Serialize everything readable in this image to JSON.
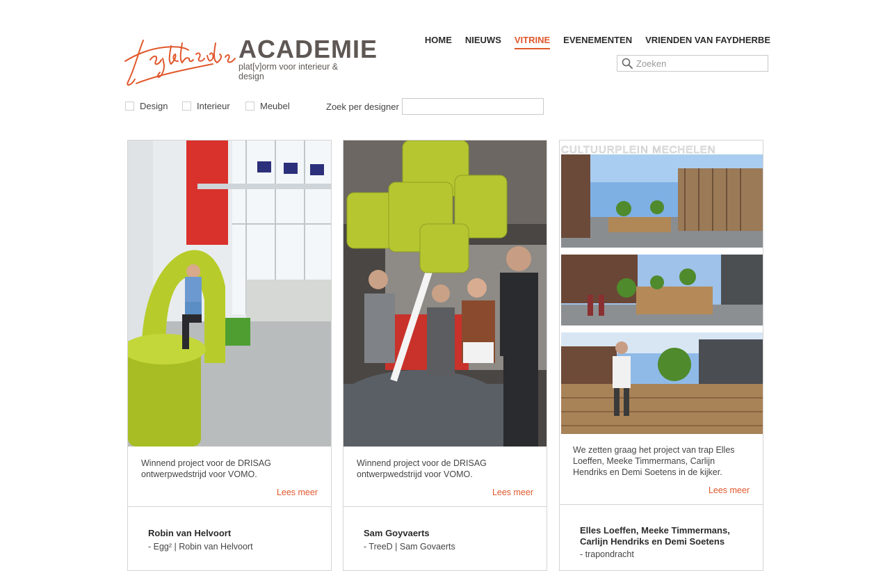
{
  "brand": {
    "signature": "Faydherbe",
    "name": "ACADEMIE",
    "tagline": "plat[v]orm voor interieur & design"
  },
  "nav": [
    {
      "label": "HOME",
      "active": false
    },
    {
      "label": "NIEUWS",
      "active": false
    },
    {
      "label": "VITRINE",
      "active": true
    },
    {
      "label": "EVENEMENTEN",
      "active": false
    },
    {
      "label": "VRIENDEN VAN FAYDHERBE",
      "active": false
    }
  ],
  "search": {
    "placeholder": "Zoeken",
    "icon": "search-icon"
  },
  "filters": {
    "design": "Design",
    "interieur": "Interieur",
    "meubel": "Meubel",
    "designer_label": "Zoek per designer"
  },
  "colors": {
    "accent": "#e0572b",
    "brand_text": "#5e5753"
  },
  "cards": [
    {
      "description": "Winnend project voor de DRISAG ontwerpwedstrijd voor VOMO.",
      "more": "Lees meer",
      "name": "Robin van Helvoort",
      "subtitle": "- Egg² | Robin van Helvoort"
    },
    {
      "description": "Winnend project voor de DRISAG ontwerpwedstrijd voor VOMO.",
      "more": "Lees meer",
      "name": "Sam Goyvaerts",
      "subtitle": "- TreeD | Sam Govaerts"
    },
    {
      "image_caption": "CULTUURPLEIN MECHELEN",
      "description": "We zetten graag het project van trap Elles Loeffen, Meeke Timmermans, Carlijn Hendriks en Demi Soetens in de kijker.",
      "more": "Lees meer",
      "name": "Elles Loeffen, Meeke Timmermans, Carlijn Hendriks en Demi Soetens",
      "subtitle": "- trapondracht"
    }
  ]
}
